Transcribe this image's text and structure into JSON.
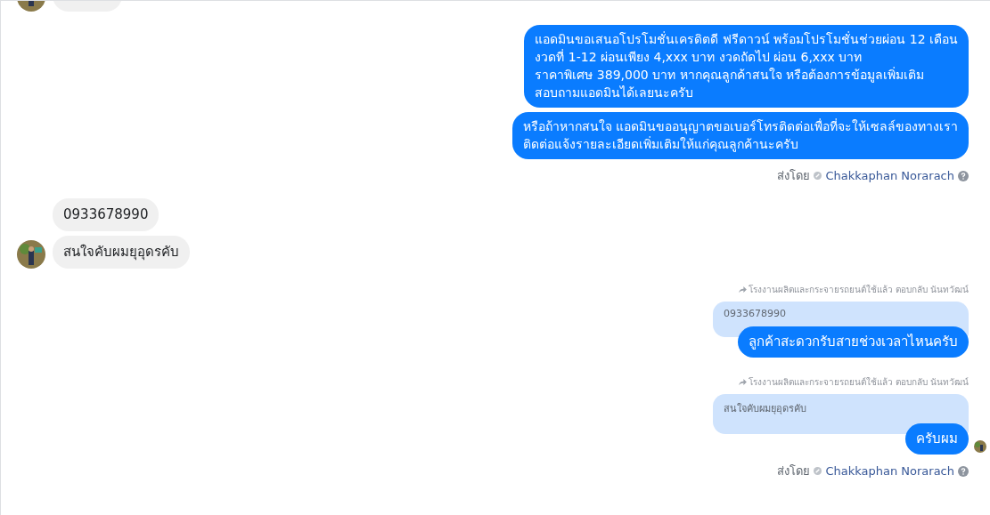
{
  "messages": [
    {
      "kind": "clipped_incoming"
    },
    {
      "kind": "outgoing",
      "bubbles": [
        {
          "lines": [
            "แอดมินขอเสนอโปรโมชั่นเครดิตดี ฟรีดาวน์ พร้อมโปรโมชั่นช่วยผ่อน 12 เดือน",
            "งวดที่ 1-12 ผ่อนเพียง 4,xxx บาท งวดถัดไป ผ่อน 6,xxx บาท",
            "ราคาพิเศษ 389,000 บาท หากคุณลูกค้าสนใจ หรือต้องการข้อมูลเพิ่มเติม",
            "สอบถามแอดมินได้เลยนะครับ"
          ]
        },
        {
          "lines": [
            "หรือถ้าหากสนใจ แอดมินขออนุญาตขอเบอร์โทรติดต่อเพื่อที่จะให้เซลล์ของทางเรา",
            "ติดต่อแจ้งรายละเอียดเพิ่มเติมให้แก่คุณลูกค้านะครับ"
          ]
        }
      ]
    },
    {
      "kind": "sent_by",
      "label": "ส่งโดย",
      "name": "Chakkaphan Norarach"
    },
    {
      "kind": "incoming",
      "bubbles": [
        "0933678990",
        "สนใจคับผมยุอุดรคับ"
      ]
    },
    {
      "kind": "reply",
      "header": "โรงงานผลิตและกระจายรถยนต์ใช้แล้ว ตอบกลับ นันทวัฒน์",
      "quoted": "0933678990",
      "text": "ลูกค้าสะดวกรับสายช่วงเวลาไหนครับ",
      "seen": false
    },
    {
      "kind": "reply",
      "header": "โรงงานผลิตและกระจายรถยนต์ใช้แล้ว ตอบกลับ นันทวัฒน์",
      "quoted": "สนใจคับผมยุอุดรคับ",
      "text": "ครับผม",
      "seen": true
    },
    {
      "kind": "sent_by",
      "label": "ส่งโดย",
      "name": "Chakkaphan Norarach"
    }
  ]
}
